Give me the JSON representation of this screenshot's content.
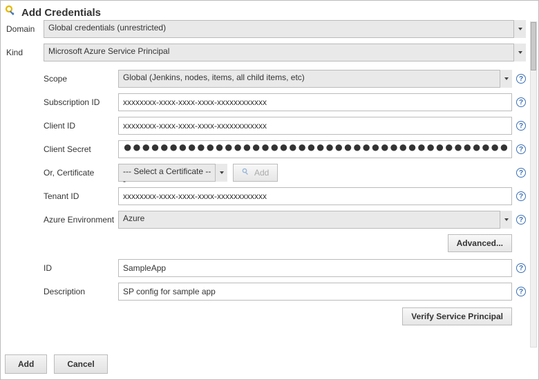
{
  "header": {
    "title": "Add Credentials"
  },
  "fields": {
    "domain": {
      "label": "Domain",
      "value": "Global credentials (unrestricted)"
    },
    "kind": {
      "label": "Kind",
      "value": "Microsoft Azure Service Principal"
    },
    "scope": {
      "label": "Scope",
      "value": "Global (Jenkins, nodes, items, all child items, etc)"
    },
    "subscriptionId": {
      "label": "Subscription ID",
      "value": "xxxxxxxx-xxxx-xxxx-xxxx-xxxxxxxxxxxx"
    },
    "clientId": {
      "label": "Client ID",
      "value": "xxxxxxxx-xxxx-xxxx-xxxx-xxxxxxxxxxxx"
    },
    "clientSecret": {
      "label": "Client Secret",
      "value": "●●●●●●●●●●●●●●●●●●●●●●●●●●●●●●●●●●●●●●●●●●●●●●●●●●●"
    },
    "certificate": {
      "label": "Or, Certificate",
      "value": "--- Select a Certificate ---",
      "addLabel": "Add"
    },
    "tenantId": {
      "label": "Tenant ID",
      "value": "xxxxxxxx-xxxx-xxxx-xxxx-xxxxxxxxxxxx"
    },
    "azureEnv": {
      "label": "Azure Environment",
      "value": "Azure"
    },
    "id": {
      "label": "ID",
      "value": "SampleApp"
    },
    "description": {
      "label": "Description",
      "value": "SP config for sample app"
    }
  },
  "buttons": {
    "advanced": "Advanced...",
    "verify": "Verify Service Principal",
    "add": "Add",
    "cancel": "Cancel"
  }
}
